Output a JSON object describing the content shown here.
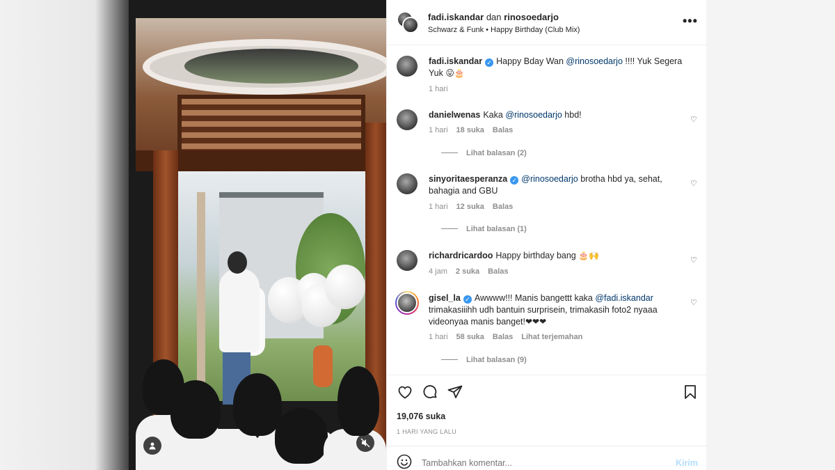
{
  "header": {
    "user1": "fadi.iskandar",
    "conj": "dan",
    "user2": "rinosoedarjo",
    "audio": "Schwarz & Funk • Happy Birthday (Club Mix)",
    "more_icon": "more-dots-icon"
  },
  "caption": {
    "user": "fadi.iskandar",
    "text_before": "Happy Bday Wan",
    "mention": "@rinosoedarjo",
    "text_after": "!!!! Yuk Segera Yuk",
    "emoji": "😛🎂",
    "time": "1 hari"
  },
  "comments": [
    {
      "user": "danielwenas",
      "text_before": "Kaka",
      "mention": "@rinosoedarjo",
      "text_after": "hbd!",
      "time": "1 hari",
      "likes": "18 suka",
      "reply": "Balas",
      "replies": "Lihat balasan (2)"
    },
    {
      "user": "sinyoritaesperanza",
      "mention": "@rinosoedarjo",
      "text_after": "brotha hbd ya, sehat, bahagia and GBU",
      "time": "1 hari",
      "likes": "12 suka",
      "reply": "Balas",
      "replies": "Lihat balasan (1)"
    },
    {
      "user": "richardricardoo",
      "text_after": "Happy birthday bang",
      "emoji": "🎂🙌",
      "time": "4 jam",
      "likes": "2 suka",
      "reply": "Balas"
    },
    {
      "user": "gisel_la",
      "text_before": "Awwww!!! Manis bangettt kaka",
      "mention": "@fadi.iskandar",
      "text_after": "trimakasiiihh udh bantuin surprisein, trimakasih foto2 nyaaa videonyaa manis banget!",
      "emoji": "❤❤❤",
      "time": "1 hari",
      "likes": "58 suka",
      "reply": "Balas",
      "translate": "Lihat terjemahan",
      "replies": "Lihat balasan (9)"
    }
  ],
  "stats": {
    "likes": "19,076 suka",
    "time_ago": "1 HARI YANG LALU"
  },
  "composer": {
    "placeholder": "Tambahkan komentar...",
    "send": "Kirim"
  },
  "icons": {
    "like": "heart-icon",
    "comment": "comment-icon",
    "share": "send-icon",
    "save": "bookmark-icon",
    "user_tag": "user-tag-icon",
    "mute": "mute-icon",
    "emoji": "emoji-icon"
  },
  "colors": {
    "accent": "#0095f6",
    "mention": "#00376b",
    "verified": "#3897f0",
    "muted": "#8e8e8e"
  }
}
